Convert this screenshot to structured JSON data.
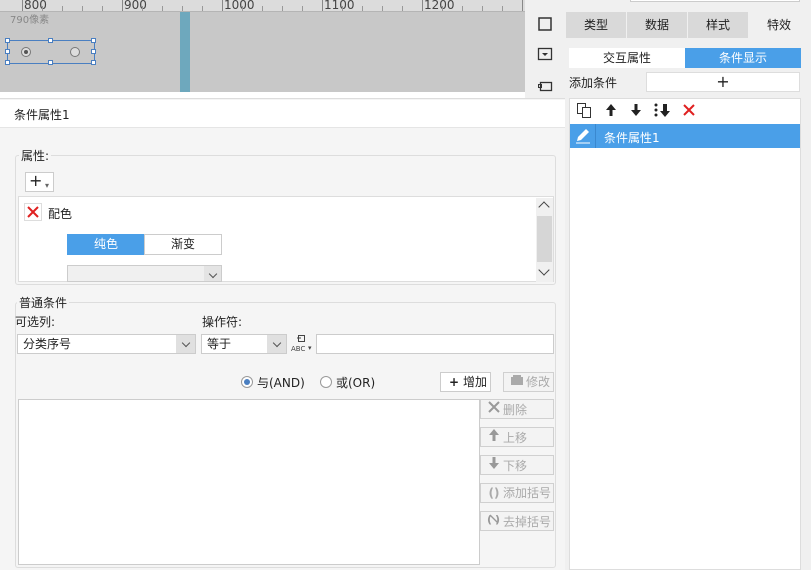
{
  "ruler": {
    "ticks": [
      "800",
      "900",
      "1000",
      "1100",
      "1200"
    ],
    "pixel_label": "790像素"
  },
  "right_panel": {
    "tabs": [
      "类型",
      "数据",
      "样式",
      "特效"
    ],
    "subtabs": [
      "交互属性",
      "条件显示"
    ],
    "add_condition_label": "添加条件",
    "add_condition_button": "+",
    "conditions": [
      "条件属性1"
    ]
  },
  "dialog": {
    "title": "条件属性1",
    "attributes": {
      "label": "属性:",
      "add_button": "+",
      "item_name": "配色",
      "segments": [
        "纯色",
        "渐变"
      ],
      "color_value": ""
    },
    "normal_conditions": {
      "label": "普通条件",
      "column_label": "可选列:",
      "column_value": "分类序号",
      "operator_label": "操作符:",
      "operator_value": "等于",
      "value": "",
      "abc_icon_text": "ABC",
      "and_label": "与(AND)",
      "or_label": "或(OR)",
      "selected_logic": "and",
      "buttons": {
        "add": "增加",
        "modify": "修改",
        "delete": "删除",
        "move_up": "上移",
        "move_down": "下移",
        "add_bracket": "添加括号",
        "remove_bracket": "去掉括号"
      }
    }
  }
}
